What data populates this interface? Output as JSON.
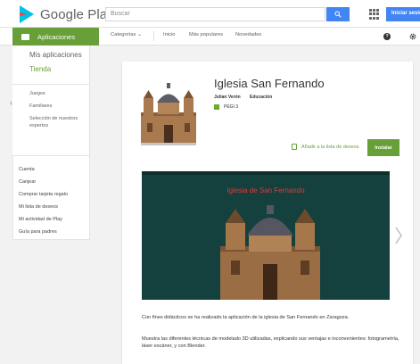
{
  "header": {
    "logo_text": "Google Play",
    "search_placeholder": "Buscar",
    "signin_label": "Iniciar sesión"
  },
  "subnav": {
    "apps_tab": "Aplicaciones",
    "categories": "Categorías",
    "home": "Inicio",
    "popular": "Más populares",
    "new": "Novedades"
  },
  "sidebar": {
    "my_apps": "Mis aplicaciones",
    "store": "Tienda",
    "items": [
      "Juegos",
      "Familiares",
      "Selección de nuestros expertos"
    ]
  },
  "account_menu": {
    "items": [
      "Cuenta",
      "Canjear",
      "Comprar tarjeta regalo",
      "Mi lista de deseos",
      "Mi actividad de Play",
      "Guía para padres"
    ]
  },
  "app": {
    "title": "Iglesia San Fernando",
    "author": "Julian Verón",
    "category": "Educación",
    "rating": "PEGI 3",
    "wishlist_label": "Añadir a la lista de deseos",
    "install_label": "Instalar",
    "screenshot_caption": "Iglesia de San Fernando",
    "description": [
      "Con fines didácticos se ha realizado la aplicación de la iglesia de San Fernando en Zaragoza.",
      "Muestra las diferentes técnicas de modelado 3D utilizadas, explicando sus ventajas e inconvenientes: fotogrametría, láser escáner, y con Blender."
    ]
  },
  "colors": {
    "accent_green": "#689f38",
    "google_blue": "#4285f4",
    "screenshot_bg": "#14403d",
    "caption_red": "#e53935"
  },
  "icons": [
    "play-logo-icon",
    "search-icon",
    "apps-grid-icon",
    "android-icon",
    "chevron-down-icon",
    "help-icon",
    "gear-icon",
    "back-chevron-icon",
    "pegi-badge-icon",
    "wishlist-icon",
    "chevron-right-icon"
  ]
}
